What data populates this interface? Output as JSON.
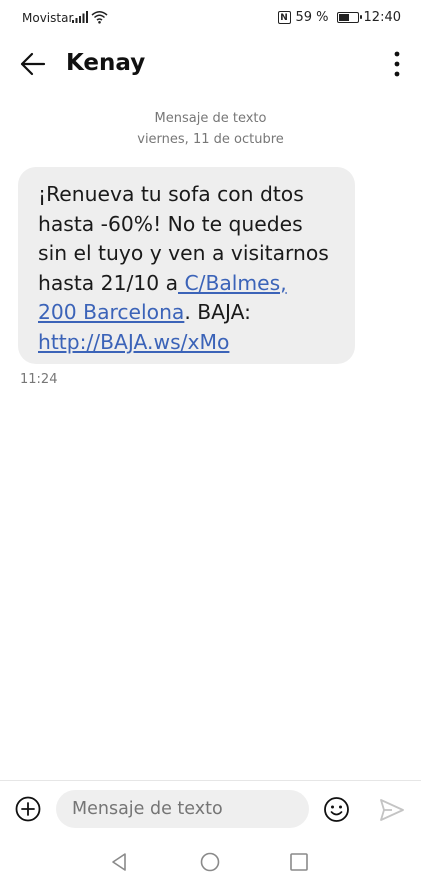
{
  "status_bar": {
    "carrier": "Movistar",
    "battery": "59 %",
    "battery_level": 0.59,
    "time": "12:40",
    "icons": [
      "signal-icon",
      "wifi-icon",
      "nfc-icon",
      "battery-icon"
    ]
  },
  "header": {
    "contact_name": "Kenay",
    "icons": [
      "back-arrow-icon",
      "more-vertical-icon"
    ]
  },
  "conversation": {
    "message_type": "Mensaje de texto",
    "date": "viernes, 11 de octubre",
    "message": {
      "line1": "¡Renueva tu sofa con dtos",
      "line2": "hasta -60%! No te quedes",
      "line3": "sin el tuyo y ven a visitarnos",
      "line4_text": "hasta 21/10 a",
      "address_part1": " C/Balmes,",
      "address_part2": "200 Barcelona",
      "line5_suffix": ". BAJA:",
      "url": "http://BAJA.ws/xMo"
    },
    "time": "11:24"
  },
  "composer": {
    "placeholder": "Mensaje de texto",
    "value": "",
    "icons": [
      "add-icon",
      "emoji-icon",
      "send-icon"
    ]
  },
  "navigation": {
    "icons": [
      "nav-back-icon",
      "nav-home-icon",
      "nav-recent-icon"
    ]
  },
  "colors": {
    "link": "#3b63b8",
    "bubble": "#eeeeee",
    "meta_text": "#777777"
  }
}
